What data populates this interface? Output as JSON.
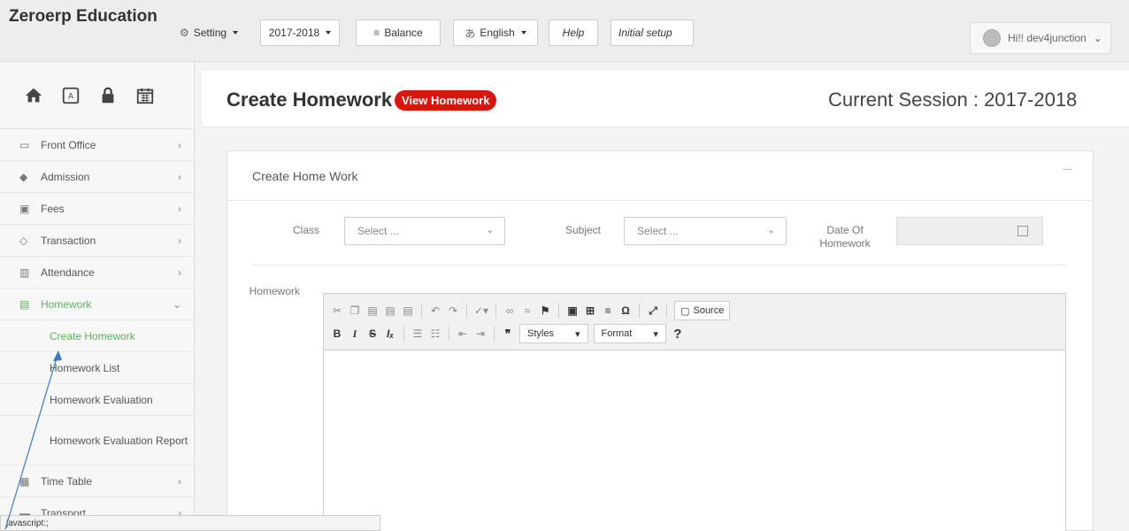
{
  "app": {
    "brand": "Zeroerp Education"
  },
  "topnav": {
    "setting": "Setting",
    "year": "2017-2018",
    "balance": "Balance",
    "language": "English",
    "help": "Help",
    "initial_setup": "Initial setup",
    "user": "Hi!! dev4junction"
  },
  "sidebar": {
    "menu": [
      {
        "label": "Front Office",
        "icon": "desktop-icon"
      },
      {
        "label": "Admission",
        "icon": "graduation-cap-icon"
      },
      {
        "label": "Fees",
        "icon": "money-icon"
      },
      {
        "label": "Transaction",
        "icon": "tag-icon"
      },
      {
        "label": "Attendance",
        "icon": "bar-chart-icon"
      },
      {
        "label": "Homework",
        "icon": "document-icon"
      }
    ],
    "submenu": [
      {
        "label": "Create Homework"
      },
      {
        "label": "Homework List"
      },
      {
        "label": "Homework Evaluation"
      },
      {
        "label": "Homework Evaluation Report"
      }
    ],
    "after": [
      {
        "label": "Time Table",
        "icon": "calendar-icon"
      },
      {
        "label": "Transport",
        "icon": "bus-icon"
      }
    ]
  },
  "page": {
    "title": "Create Homework",
    "view_badge": "View Homework",
    "session": "Current Session : 2017-2018"
  },
  "form": {
    "panel_title": "Create Home Work",
    "class_label": "Class",
    "class_value": "Select ...",
    "subject_label": "Subject",
    "subject_value": "Select ...",
    "date_label": "Date Of Homework",
    "homework_label": "Homework"
  },
  "editor": {
    "source": "Source",
    "styles": "Styles",
    "format": "Format",
    "help": "?"
  },
  "statusbar": {
    "text": "javascript:;"
  },
  "colors": {
    "accent_green": "#5bb35b",
    "badge_red": "#d9160d"
  }
}
